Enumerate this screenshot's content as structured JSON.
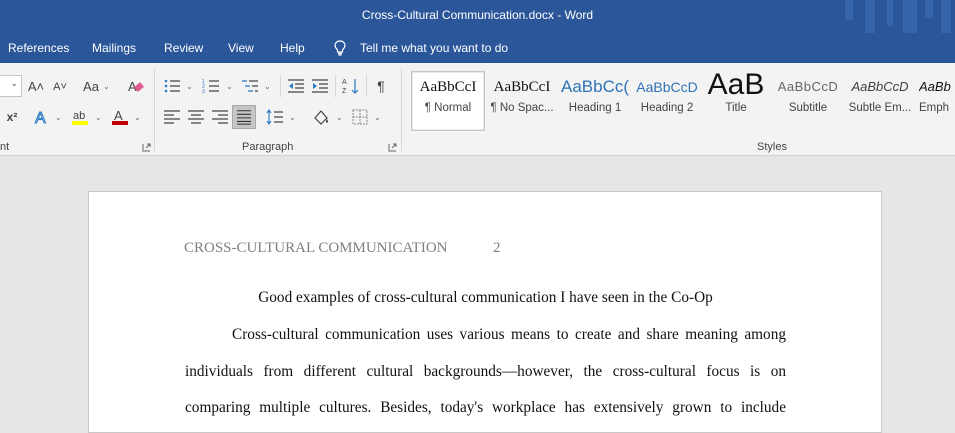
{
  "window": {
    "title": "Cross-Cultural Communication.docx  -  Word"
  },
  "menu": {
    "tabs": [
      "References",
      "Mailings",
      "Review",
      "View",
      "Help"
    ],
    "tell_me": "Tell me what you want to do"
  },
  "ribbon": {
    "groups": {
      "font": "nt",
      "paragraph": "Paragraph",
      "styles": "Styles"
    },
    "font_buttons": {
      "grow": "A˄",
      "shrink": "A˅",
      "case": "Aa",
      "superscript": "x²"
    },
    "styles": [
      {
        "preview": "AaBbCcI",
        "name": "¶ Normal",
        "selected": true
      },
      {
        "preview": "AaBbCcI",
        "name": "¶ No Spac..."
      },
      {
        "preview": "AaBbCc(",
        "name": "Heading 1"
      },
      {
        "preview": "AaBbCcD",
        "name": "Heading 2"
      },
      {
        "preview": "AaB",
        "name": "Title"
      },
      {
        "preview": "AaBbCcD",
        "name": "Subtitle"
      },
      {
        "preview": "AaBbCcD",
        "name": "Subtle Em..."
      },
      {
        "preview": "AaBb",
        "name": "Emph"
      }
    ],
    "colors": {
      "highlight": "#ffff00",
      "font_color": "#c00000"
    }
  },
  "document": {
    "running_head": "CROSS-CULTURAL COMMUNICATION",
    "page_number": "2",
    "heading": "Good examples of cross-cultural communication I have seen in the Co-Op",
    "lines": [
      "Cross-cultural communication uses various means to create and share meaning among",
      "individuals from different cultural backgrounds—however, the cross-cultural focus is on",
      "comparing multiple cultures. Besides, today's workplace has extensively grown to include"
    ]
  },
  "theme": {
    "brand": "#2b579a",
    "ribbon_bg": "#f3f3f3",
    "doc_bg": "#e6e6e6"
  }
}
